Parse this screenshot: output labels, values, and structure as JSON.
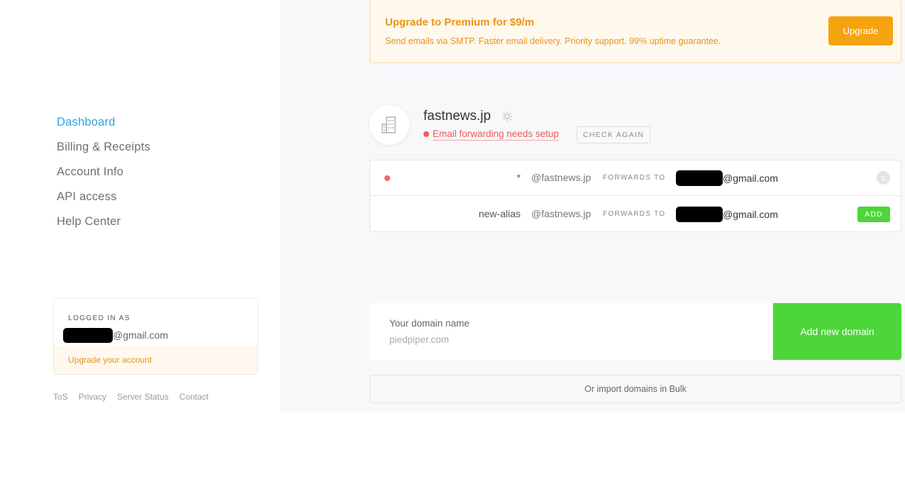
{
  "sidebar": {
    "nav": [
      {
        "label": "Dashboard",
        "active": true
      },
      {
        "label": "Billing & Receipts",
        "active": false
      },
      {
        "label": "Account Info",
        "active": false
      },
      {
        "label": "API access",
        "active": false
      },
      {
        "label": "Help Center",
        "active": false
      }
    ],
    "account": {
      "logged_in_label": "LOGGED IN AS",
      "email_suffix": "@gmail.com",
      "upgrade_link": "Upgrade your account"
    },
    "footer": [
      "ToS",
      "Privacy",
      "Server Status",
      "Contact"
    ]
  },
  "banner": {
    "title": "Upgrade to Premium for $9/m",
    "description": "Send emails via SMTP. Faster email delivery. Priority support. 99% uptime guarantee.",
    "button": "Upgrade"
  },
  "domain": {
    "name": "fastnews.jp",
    "status": "Email forwarding needs setup",
    "check_again": "CHECK AGAIN",
    "aliases": [
      {
        "alias": "*",
        "domain": "@fastnews.jp",
        "forwards_label": "FORWARDS TO",
        "target_suffix": "@gmail.com",
        "action": "x"
      },
      {
        "alias": "new-alias",
        "domain": "@fastnews.jp",
        "forwards_label": "FORWARDS TO",
        "target_suffix": "@gmail.com",
        "action": "ADD"
      }
    ]
  },
  "add_domain": {
    "label": "Your domain name",
    "placeholder": "piedpiper.com",
    "button": "Add new domain"
  },
  "bulk_import": "Or import domains in Bulk",
  "colors": {
    "accent_blue": "#2ba6de",
    "premium_orange": "#f5a30f",
    "success_green": "#4cd63a",
    "error_red": "#ef5a5a"
  }
}
